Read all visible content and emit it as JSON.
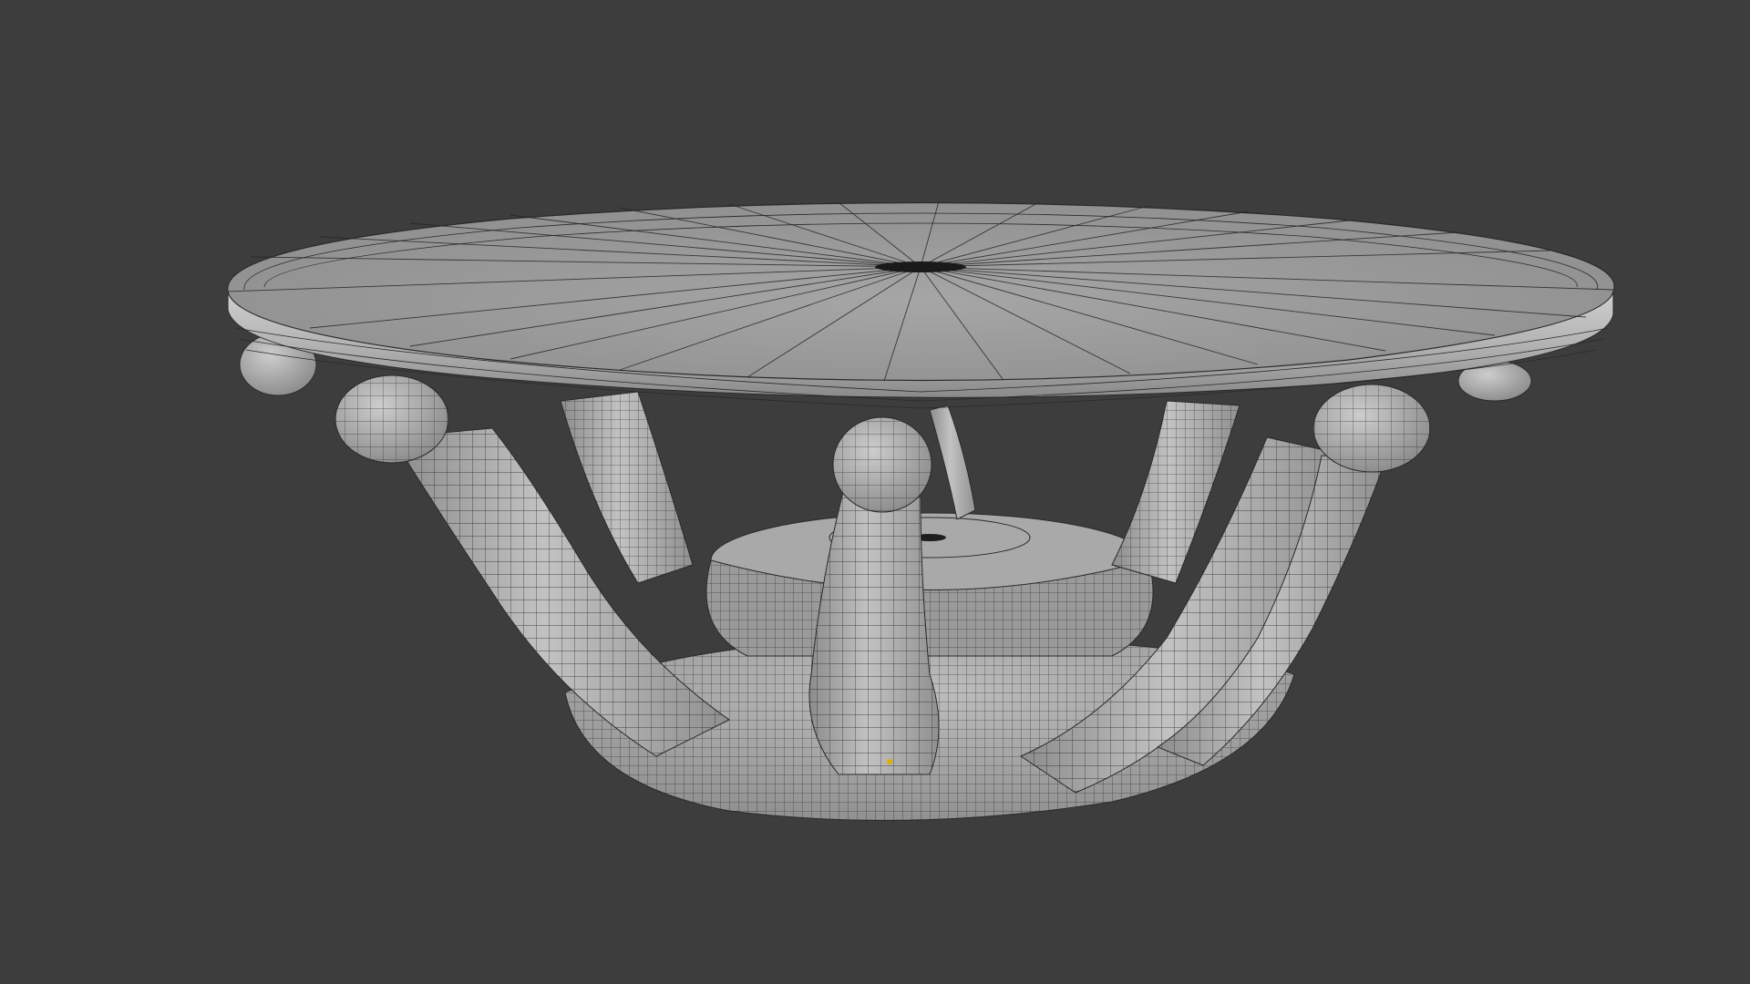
{
  "viewport": {
    "view_mode": "3d-viewport",
    "shading": "solid",
    "overlay": "wireframe",
    "object_name": "",
    "origin_marker": "object-origin"
  },
  "colors": {
    "background": "#3d3d3d",
    "surface": "#a8a8a8",
    "surface_light": "#c4c4c4",
    "surface_dark": "#6e6e6e",
    "wire": "#1e1e1e",
    "origin": "#e0b000"
  },
  "model": {
    "description_visible": false,
    "parts": [
      "tabletop",
      "top-edge-band",
      "leg-spheres",
      "legs",
      "base-bowl",
      "base-disc"
    ]
  }
}
